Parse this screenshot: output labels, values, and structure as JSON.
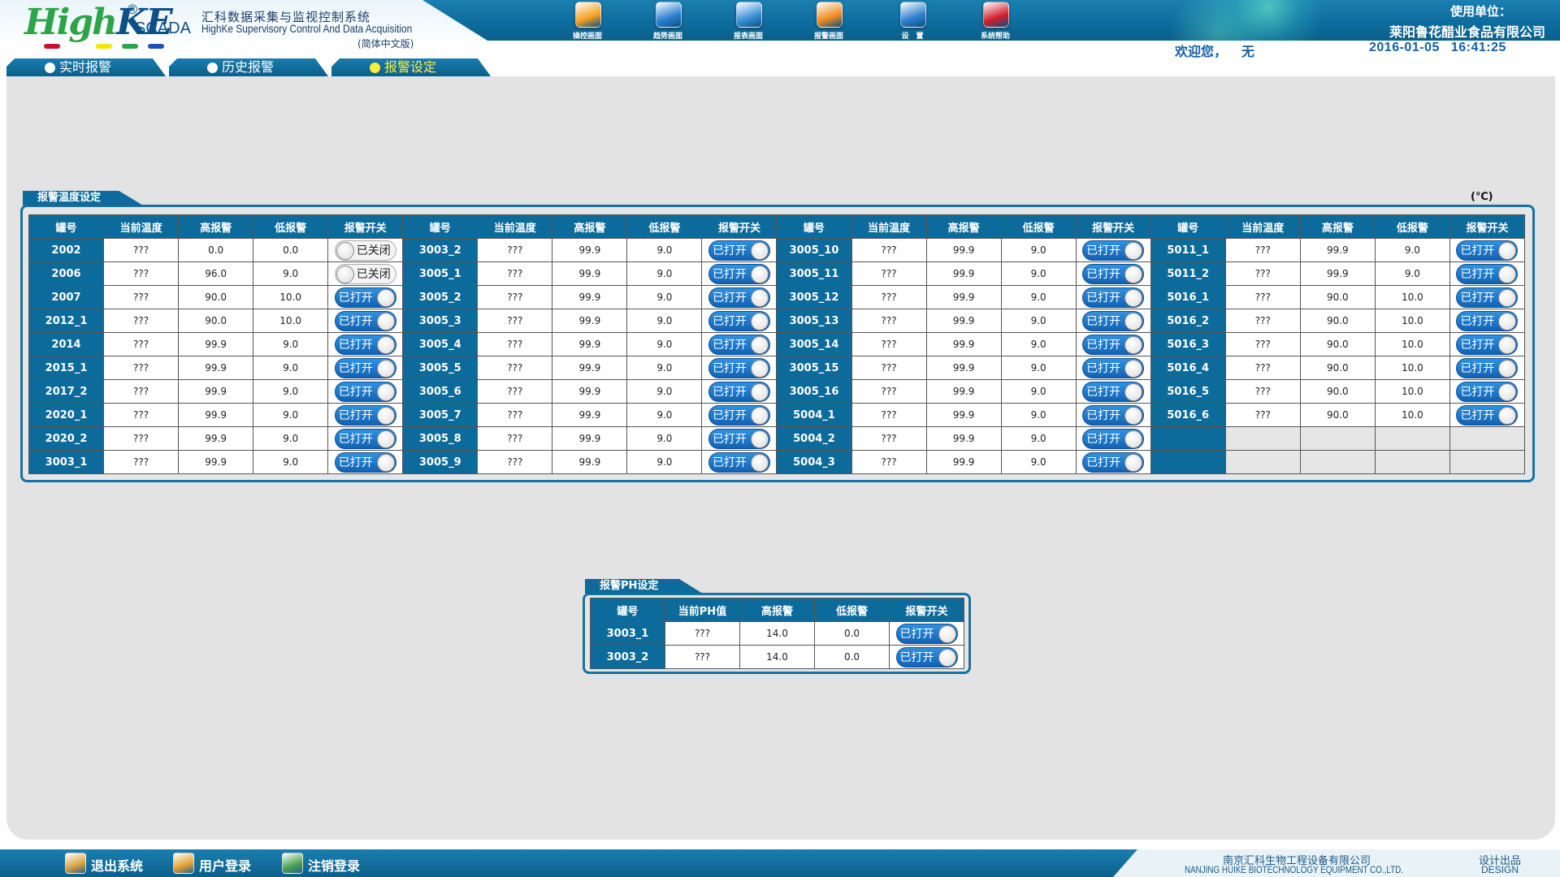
{
  "header": {
    "logo_text_high": "High",
    "logo_text_ke": "KE",
    "logo_reg": "®",
    "logo_scada": "SCADA",
    "title_cn": "汇科数据采集与监视控制系统",
    "title_en": "HighKe Supervisory Control And Data Acquisition",
    "lang": "(简体中文版)",
    "dot_colors": [
      "#c8102e",
      "#f2e600",
      "#2ea44a",
      "#1d4fb8"
    ],
    "nav": [
      {
        "label": "操控画面",
        "icon": "hand-touch-icon",
        "color": "#f4a020"
      },
      {
        "label": "趋势画面",
        "icon": "magnifier-trend-icon",
        "color": "#2b7fd0"
      },
      {
        "label": "报表画面",
        "icon": "report-gear-icon",
        "color": "#3a8fd6"
      },
      {
        "label": "报警画面",
        "icon": "alarm-bell-icon",
        "color": "#f08a20"
      },
      {
        "label": "设　置",
        "icon": "settings-tools-icon",
        "color": "#2f7fd0"
      },
      {
        "label": "系统帮助",
        "icon": "help-question-icon",
        "color": "#d21f2a"
      }
    ],
    "unit_label": "使用单位：",
    "unit_name": "莱阳鲁花醋业食品有限公司",
    "welcome": "欢迎您，",
    "user": "无",
    "date": "2016-01-05",
    "time": "16:41:25"
  },
  "tabs": [
    {
      "label": "实时报警",
      "active": false
    },
    {
      "label": "历史报警",
      "active": false
    },
    {
      "label": "报警设定",
      "active": true
    }
  ],
  "temp_section": {
    "title": "报警温度设定",
    "unit": "(℃)",
    "headers": [
      "罐号",
      "当前温度",
      "高报警",
      "低报警",
      "报警开关"
    ],
    "columns": [
      [
        {
          "id": "2002",
          "current": "???",
          "high": "0.0",
          "low": "0.0",
          "on": false
        },
        {
          "id": "2006",
          "current": "???",
          "high": "96.0",
          "low": "9.0",
          "on": false
        },
        {
          "id": "2007",
          "current": "???",
          "high": "90.0",
          "low": "10.0",
          "on": true
        },
        {
          "id": "2012_1",
          "current": "???",
          "high": "90.0",
          "low": "10.0",
          "on": true
        },
        {
          "id": "2014",
          "current": "???",
          "high": "99.9",
          "low": "9.0",
          "on": true
        },
        {
          "id": "2015_1",
          "current": "???",
          "high": "99.9",
          "low": "9.0",
          "on": true
        },
        {
          "id": "2017_2",
          "current": "???",
          "high": "99.9",
          "low": "9.0",
          "on": true
        },
        {
          "id": "2020_1",
          "current": "???",
          "high": "99.9",
          "low": "9.0",
          "on": true
        },
        {
          "id": "2020_2",
          "current": "???",
          "high": "99.9",
          "low": "9.0",
          "on": true
        },
        {
          "id": "3003_1",
          "current": "???",
          "high": "99.9",
          "low": "9.0",
          "on": true
        }
      ],
      [
        {
          "id": "3003_2",
          "current": "???",
          "high": "99.9",
          "low": "9.0",
          "on": true
        },
        {
          "id": "3005_1",
          "current": "???",
          "high": "99.9",
          "low": "9.0",
          "on": true
        },
        {
          "id": "3005_2",
          "current": "???",
          "high": "99.9",
          "low": "9.0",
          "on": true
        },
        {
          "id": "3005_3",
          "current": "???",
          "high": "99.9",
          "low": "9.0",
          "on": true
        },
        {
          "id": "3005_4",
          "current": "???",
          "high": "99.9",
          "low": "9.0",
          "on": true
        },
        {
          "id": "3005_5",
          "current": "???",
          "high": "99.9",
          "low": "9.0",
          "on": true
        },
        {
          "id": "3005_6",
          "current": "???",
          "high": "99.9",
          "low": "9.0",
          "on": true
        },
        {
          "id": "3005_7",
          "current": "???",
          "high": "99.9",
          "low": "9.0",
          "on": true
        },
        {
          "id": "3005_8",
          "current": "???",
          "high": "99.9",
          "low": "9.0",
          "on": true
        },
        {
          "id": "3005_9",
          "current": "???",
          "high": "99.9",
          "low": "9.0",
          "on": true
        }
      ],
      [
        {
          "id": "3005_10",
          "current": "???",
          "high": "99.9",
          "low": "9.0",
          "on": true
        },
        {
          "id": "3005_11",
          "current": "???",
          "high": "99.9",
          "low": "9.0",
          "on": true
        },
        {
          "id": "3005_12",
          "current": "???",
          "high": "99.9",
          "low": "9.0",
          "on": true
        },
        {
          "id": "3005_13",
          "current": "???",
          "high": "99.9",
          "low": "9.0",
          "on": true
        },
        {
          "id": "3005_14",
          "current": "???",
          "high": "99.9",
          "low": "9.0",
          "on": true
        },
        {
          "id": "3005_15",
          "current": "???",
          "high": "99.9",
          "low": "9.0",
          "on": true
        },
        {
          "id": "3005_16",
          "current": "???",
          "high": "99.9",
          "low": "9.0",
          "on": true
        },
        {
          "id": "5004_1",
          "current": "???",
          "high": "99.9",
          "low": "9.0",
          "on": true
        },
        {
          "id": "5004_2",
          "current": "???",
          "high": "99.9",
          "low": "9.0",
          "on": true
        },
        {
          "id": "5004_3",
          "current": "???",
          "high": "99.9",
          "low": "9.0",
          "on": true
        }
      ],
      [
        {
          "id": "5011_1",
          "current": "???",
          "high": "99.9",
          "low": "9.0",
          "on": true
        },
        {
          "id": "5011_2",
          "current": "???",
          "high": "99.9",
          "low": "9.0",
          "on": true
        },
        {
          "id": "5016_1",
          "current": "???",
          "high": "90.0",
          "low": "10.0",
          "on": true
        },
        {
          "id": "5016_2",
          "current": "???",
          "high": "90.0",
          "low": "10.0",
          "on": true
        },
        {
          "id": "5016_3",
          "current": "???",
          "high": "90.0",
          "low": "10.0",
          "on": true
        },
        {
          "id": "5016_4",
          "current": "???",
          "high": "90.0",
          "low": "10.0",
          "on": true
        },
        {
          "id": "5016_5",
          "current": "???",
          "high": "90.0",
          "low": "10.0",
          "on": true
        },
        {
          "id": "5016_6",
          "current": "???",
          "high": "90.0",
          "low": "10.0",
          "on": true
        },
        null,
        null
      ]
    ]
  },
  "ph_section": {
    "title": "报警PH设定",
    "headers": [
      "罐号",
      "当前PH值",
      "高报警",
      "低报警",
      "报警开关"
    ],
    "rows": [
      {
        "id": "3003_1",
        "current": "???",
        "high": "14.0",
        "low": "0.0",
        "on": true
      },
      {
        "id": "3003_2",
        "current": "???",
        "high": "14.0",
        "low": "0.0",
        "on": true
      }
    ]
  },
  "toggle_labels": {
    "on": "已打开",
    "off": "已关闭"
  },
  "footer": {
    "buttons": [
      {
        "label": "退出系统",
        "icon": "exit-system-icon",
        "color": "#d8a040"
      },
      {
        "label": "用户登录",
        "icon": "user-login-icon",
        "color": "#e0a030"
      },
      {
        "label": "注销登录",
        "icon": "logout-user-icon",
        "color": "#4aa050"
      }
    ],
    "company_cn": "南京汇科生物工程设备有限公司",
    "company_en": "NANJING HUIKE BIOTECHNOLOGY EQUIPMENT CO.,LTD.",
    "design_cn": "设计出品",
    "design_en": "DESIGN"
  }
}
